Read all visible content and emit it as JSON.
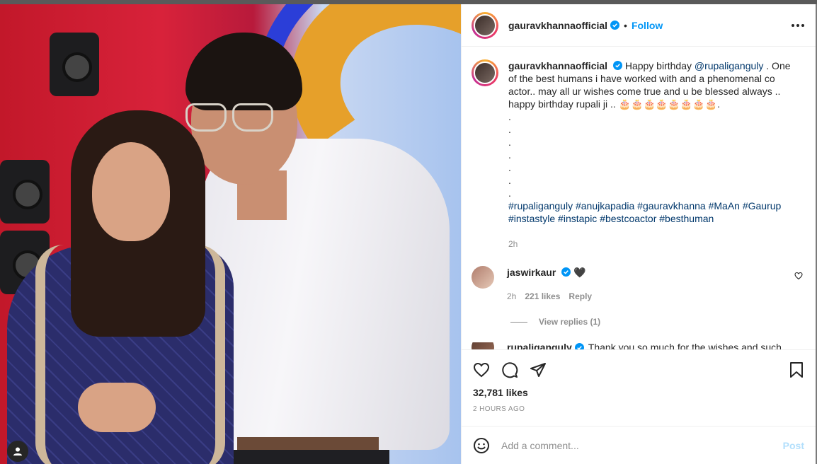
{
  "post": {
    "username": "gauravkhannaofficial",
    "separator": "•",
    "follow_label": "Follow"
  },
  "caption": {
    "username": "gauravkhannaofficial",
    "text_1": " Happy birthday ",
    "mention": "@rupaliganguly",
    "text_2": " . One of the best humans i have worked with and a phenomenal co actor.. may all ur wishes come true and u be blessed always .. happy birthday rupali ji .. 🎂🎂🎂🎂🎂🎂🎂🎂.",
    "dots": [
      ".",
      ".",
      ".",
      ".",
      ".",
      ".",
      "."
    ],
    "hashtags": [
      "#rupaliganguly",
      "#anujkapadia",
      "#gauravkhanna",
      "#MaAn",
      "#Gaurup",
      "#instastyle",
      "#instapic",
      "#bestcoactor",
      "#besthuman"
    ],
    "time": "2h"
  },
  "comments": [
    {
      "username": "jaswirkaur",
      "text": "🖤",
      "time": "2h",
      "likes": "221 likes",
      "reply_label": "Reply",
      "view_replies": "View replies (1)"
    }
  ],
  "next_comment": {
    "username": "rupaliganguly",
    "text": "Thank you so much for the wishes and such"
  },
  "footer": {
    "likes": "32,781 likes",
    "posted": "2 HOURS AGO",
    "comment_placeholder": "Add a comment...",
    "post_label": "Post"
  },
  "colors": {
    "link": "#00376b",
    "follow": "#0095f6",
    "post_disabled": "#b2dffc",
    "muted": "#8e8e8e"
  },
  "icons": [
    "verified-badge-icon",
    "more-options-icon",
    "heart-icon",
    "comment-icon",
    "share-icon",
    "save-icon",
    "emoji-icon",
    "profile-tag-icon"
  ]
}
